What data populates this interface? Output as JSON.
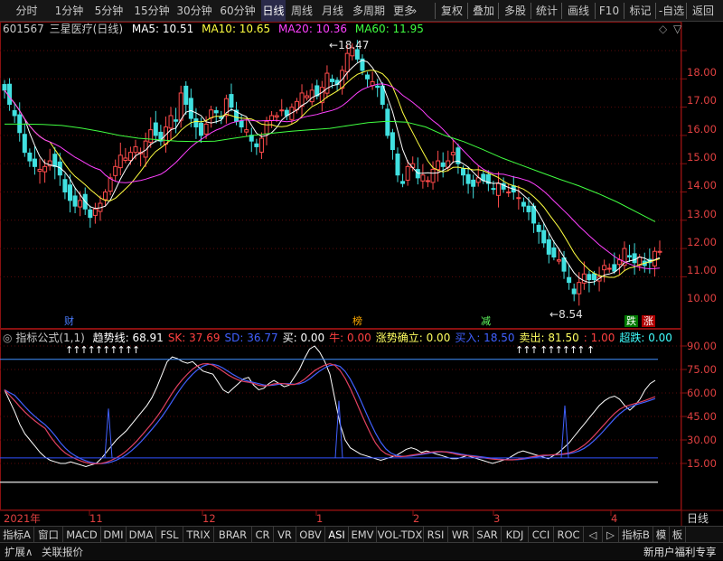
{
  "toolbar": {
    "left": [
      "分时",
      "1分钟",
      "5分钟",
      "15分钟",
      "30分钟",
      "60分钟",
      "日线",
      "周线",
      "月线",
      "多周期",
      "更多"
    ],
    "active": "日线",
    "right": [
      "复权",
      "叠加",
      "多股",
      "统计",
      "画线",
      "F10",
      "标记",
      "-自选",
      "返回"
    ]
  },
  "stock": {
    "code": "601567",
    "name": "三星医疗",
    "period": "(日线)"
  },
  "ma": [
    {
      "label": "MA5: 10.51",
      "color": "#ffffff"
    },
    {
      "label": "MA10: 10.65",
      "color": "#ffff40"
    },
    {
      "label": "MA20: 10.36",
      "color": "#ff40ff"
    },
    {
      "label": "MA60: 11.95",
      "color": "#40ff40"
    }
  ],
  "price_axis": [
    "18.00",
    "17.00",
    "16.00",
    "15.00",
    "14.00",
    "13.00",
    "12.00",
    "11.00",
    "10.00"
  ],
  "annotations": {
    "high": "18.47",
    "low": "8.54"
  },
  "events": [
    {
      "text": "财",
      "color": "#4a7cff",
      "bg": "#000000"
    },
    {
      "text": "榜",
      "color": "#ffaa00",
      "bg": "#000000"
    },
    {
      "text": "减",
      "color": "#60ff60",
      "bg": "#000000"
    },
    {
      "text": "跌",
      "color": "#ffffff",
      "bg": "#007a00"
    },
    {
      "text": "涨",
      "color": "#ffffff",
      "bg": "#b00000"
    }
  ],
  "indicator": {
    "title": "指标公式(1,1)",
    "values": [
      {
        "label": "趋势线: 68.91",
        "color": "#ffffff"
      },
      {
        "label": "SK: 37.69",
        "color": "#ff4040"
      },
      {
        "label": "SD: 36.77",
        "color": "#4060ff"
      },
      {
        "label": "买: 0.00",
        "color": "#ffffff"
      },
      {
        "label": "牛: 0.00",
        "color": "#ff4040"
      },
      {
        "label": "涨势确立: 0.00",
        "color": "#ffff60"
      },
      {
        "label": "买入: 18.50",
        "color": "#4060ff"
      },
      {
        "label": "卖出: 81.50",
        "color": "#ffff60"
      },
      {
        "label": ": 1.00",
        "color": "#ff4040"
      },
      {
        "label": "超跌: 0.00",
        "color": "#40ffff"
      }
    ],
    "axis": [
      "90.00",
      "75.00",
      "60.00",
      "45.00",
      "30.00",
      "15.00"
    ],
    "arrows_a": "↑↑↑↑↑↑↑↑↑↑",
    "arrows_b": "↑↑↑ ↑↑↑↑↑↑ ↑"
  },
  "time_axis": [
    "2021年",
    "11",
    "12",
    "1",
    "2",
    "3",
    "4"
  ],
  "time_right": "日线",
  "tabs": [
    "指标A",
    "窗口",
    "MACD",
    "DMI",
    "DMA",
    "FSL",
    "TRIX",
    "BRAR",
    "CR",
    "VR",
    "OBV",
    "ASI",
    "EMV",
    "VOL-TDX",
    "RSI",
    "WR",
    "SAR",
    "KDJ",
    "CCI",
    "ROC",
    "◁",
    "▷",
    "指标B",
    "模",
    "板"
  ],
  "active_tab": "ASI",
  "status": {
    "expand": "扩展∧",
    "related": "关联报价",
    "promo": "新用户福利专享"
  },
  "chart_data": {
    "type": "candlestick",
    "colors": {
      "up": "#ff4b4b",
      "down": "#40e0e0",
      "ma5": "#ffffff",
      "ma10": "#ffff40",
      "ma20": "#ff40ff",
      "ma60": "#40ff40"
    },
    "price_range": [
      8.3,
      18.9
    ],
    "closes": [
      16.6,
      16.1,
      15.7,
      15.1,
      14.4,
      14.1,
      13.9,
      13.8,
      13.9,
      14.1,
      13.9,
      13.6,
      13.0,
      12.7,
      12.5,
      12.7,
      12.4,
      12.1,
      12.4,
      12.6,
      13.0,
      13.5,
      13.9,
      14.3,
      14.2,
      14.4,
      14.6,
      14.4,
      14.8,
      15.2,
      15.0,
      14.8,
      15.3,
      15.7,
      15.5,
      16.5,
      16.1,
      15.6,
      15.3,
      15.0,
      15.4,
      15.9,
      15.8,
      15.6,
      16.3,
      16.0,
      15.5,
      15.3,
      15.2,
      14.8,
      14.6,
      14.9,
      15.5,
      15.7,
      15.7,
      15.9,
      15.7,
      16.0,
      16.2,
      16.5,
      16.4,
      16.6,
      16.4,
      16.7,
      17.2,
      16.9,
      16.8,
      17.3,
      17.9,
      18.1,
      17.7,
      17.3,
      17.0,
      16.9,
      16.7,
      16.1,
      15.0,
      14.5,
      13.6,
      13.3,
      13.9,
      14.0,
      13.5,
      13.6,
      13.4,
      13.8,
      14.1,
      13.9,
      14.1,
      14.4,
      14.0,
      13.6,
      13.3,
      13.2,
      13.5,
      13.4,
      13.3,
      13.1,
      13.3,
      13.1,
      13.0,
      13.0,
      12.8,
      12.5,
      12.3,
      11.9,
      11.6,
      11.2,
      10.8,
      10.7,
      10.6,
      10.2,
      9.8,
      9.4,
      9.8,
      10.1,
      9.9,
      9.9,
      10.0,
      10.4,
      10.3,
      10.2,
      10.6,
      11.0,
      10.7,
      10.5,
      10.7,
      10.4,
      10.5,
      10.9,
      10.9
    ],
    "ma60": [
      15.4,
      15.4,
      15.39,
      15.35,
      15.26,
      15.14,
      15.0,
      14.9,
      14.85,
      14.8,
      14.78,
      14.8,
      14.9,
      15.0,
      15.08,
      15.15,
      15.2,
      15.25,
      15.35,
      15.45,
      15.5,
      15.47,
      15.3,
      15.0,
      14.78,
      14.5,
      14.2,
      13.95,
      13.7,
      13.45,
      13.22,
      12.95,
      12.65,
      12.3,
      11.95
    ]
  }
}
